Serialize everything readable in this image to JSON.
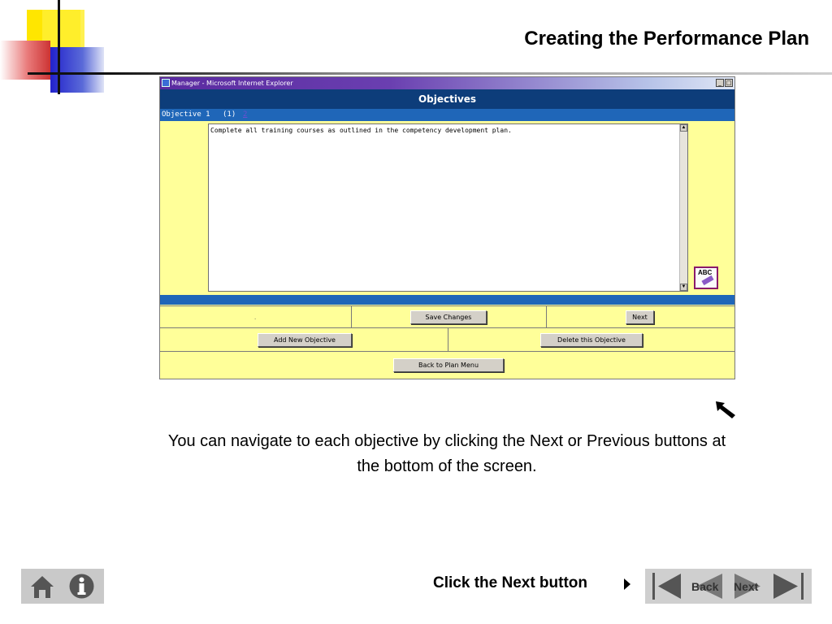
{
  "slide": {
    "title": "Creating the Performance Plan",
    "explanation": "You can navigate to each objective by clicking the Next or Previous buttons at the bottom of the screen.",
    "instruction": "Click the Next button"
  },
  "browser": {
    "window_title": "Manager - Microsoft Internet Explorer",
    "min_glyph": "_",
    "max_glyph": "□"
  },
  "form": {
    "header": "Objectives",
    "objective_label": "Objective 1",
    "objective_count": "(1)",
    "next_link": "2",
    "objective_text": "Complete all training courses as outlined in the competency development plan.",
    "spell_check_label": "ABC",
    "dot": ".",
    "buttons": {
      "save_changes": "Save Changes",
      "next": "Next",
      "add_new_objective": "Add New Objective",
      "delete_objective": "Delete this Objective",
      "back_to_plan_menu": "Back to Plan Menu"
    }
  },
  "navigation": {
    "back_label": "Back",
    "next_label": "Next"
  },
  "colors": {
    "form_background": "#ffff99",
    "header_blue": "#0d3d7a",
    "bar_blue": "#1f66b8",
    "titlebar_purple": "#5a2aa0"
  }
}
